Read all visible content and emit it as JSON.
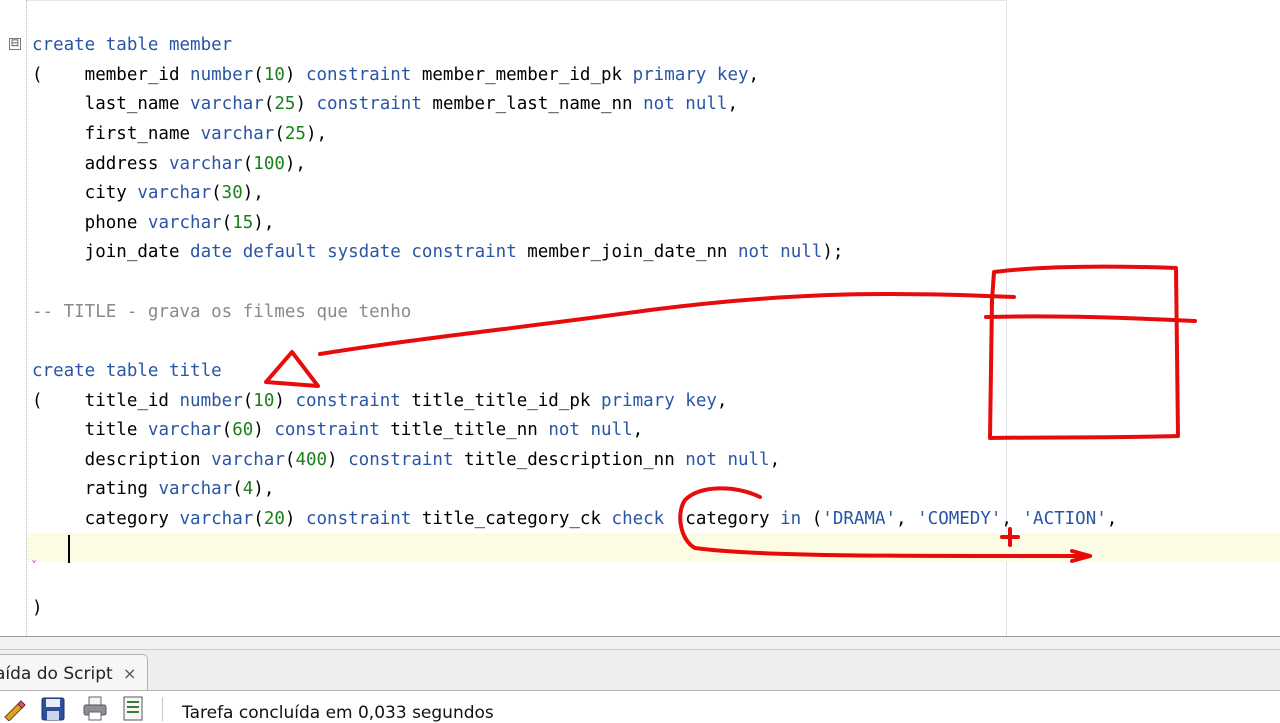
{
  "editor": {
    "lines": [
      [
        "create table member"
      ],
      [
        "(    member_id number(10) constraint member_member_id_pk primary key,"
      ],
      [
        "     last_name varchar(25) constraint member_last_name_nn not null,"
      ],
      [
        "     first_name varchar(25),"
      ],
      [
        "     address varchar(100),"
      ],
      [
        "     city varchar(30),"
      ],
      [
        "     phone varchar(15),"
      ],
      [
        "     join_date date default sysdate constraint member_join_date_nn not null);"
      ],
      [
        "-- TITLE - grava os filmes que tenho"
      ],
      [
        "create table title"
      ],
      [
        "(    title_id number(10) constraint title_title_id_pk primary key,"
      ],
      [
        "     title varchar(60) constraint title_title_nn not null,"
      ],
      [
        "     description varchar(400) constraint title_description_nn not null,"
      ],
      [
        "     rating varchar(4),"
      ],
      [
        "     category varchar(20) constraint title_category_ck check (category in ('DRAMA', 'COMEDY', 'ACTION',"
      ],
      [
        ")"
      ]
    ],
    "fold_marker": "⊟",
    "warning_marker": "ˬ",
    "colors": {
      "keyword": "#2a55a5",
      "number": "#1b7f1b",
      "comment": "#8a8a8a",
      "annotation": "#e80b0b",
      "current_line": "#fcfce4"
    }
  },
  "bottom_panel": {
    "tab_label": "aída do Script",
    "tab_close": "×",
    "status": "Tarefa concluída em 0,033 segundos",
    "toolbar_icons": [
      "pencil-eraser-icon",
      "save-icon",
      "print-icon",
      "document-icon"
    ]
  }
}
